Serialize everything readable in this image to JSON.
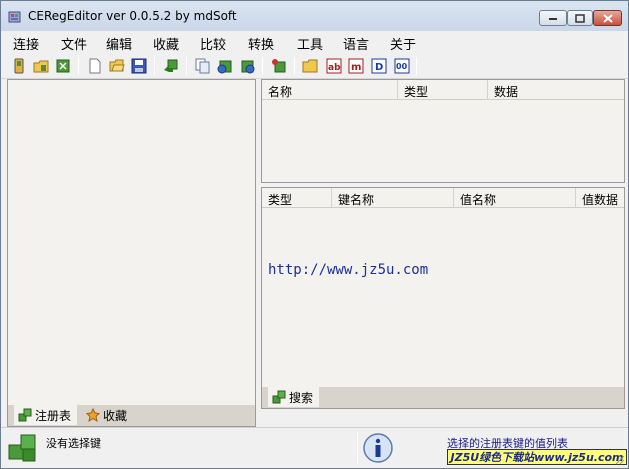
{
  "window": {
    "title": "CERegEditor ver 0.0.5.2 by mdSoft"
  },
  "menu": {
    "items": [
      "连接",
      "文件",
      "编辑",
      "收藏",
      "比较",
      "转换",
      "工具",
      "语言",
      "关于"
    ]
  },
  "toolbar": {
    "buttons": [
      {
        "icon": "connect-device-icon"
      },
      {
        "icon": "connect-folder-icon"
      },
      {
        "icon": "disconnect-icon"
      },
      {
        "icon": "new-file-icon"
      },
      {
        "icon": "open-folder-icon"
      },
      {
        "icon": "save-disk-icon"
      },
      {
        "icon": "registry-key-arrow-icon"
      },
      {
        "icon": "copy-icon"
      },
      {
        "icon": "export-key-icon"
      },
      {
        "icon": "import-key-icon"
      },
      {
        "icon": "add-key-icon"
      },
      {
        "icon": "new-folder-icon"
      },
      {
        "icon": "string-value-icon",
        "label": "ab"
      },
      {
        "icon": "multi-string-value-icon",
        "label": "m"
      },
      {
        "icon": "dword-value-icon",
        "label": "D"
      },
      {
        "icon": "binary-value-icon",
        "label": "00"
      }
    ]
  },
  "left_panel": {
    "tabs": [
      {
        "label": "注册表",
        "icon": "registry-cubes-icon",
        "active": true
      },
      {
        "label": "收藏",
        "icon": "favorites-icon",
        "active": false
      }
    ]
  },
  "values_list": {
    "columns": [
      "名称",
      "类型",
      "数据"
    ]
  },
  "search_list": {
    "columns": [
      "类型",
      "键名称",
      "值名称",
      "值数据"
    ],
    "overlay_text": "http://www.jz5u.com",
    "tabs": [
      {
        "label": "搜索",
        "icon": "registry-cubes-icon",
        "active": true
      }
    ]
  },
  "status": {
    "left_text": "没有选择键",
    "right_text": "选择的注册表键的值列表",
    "stamp_text": "JZ5U绿色下载站www.jz5u.com"
  },
  "colors": {
    "link": "#1a2fa0",
    "stamp_bg": "#ffff7a",
    "close_button": "#c9503b"
  }
}
